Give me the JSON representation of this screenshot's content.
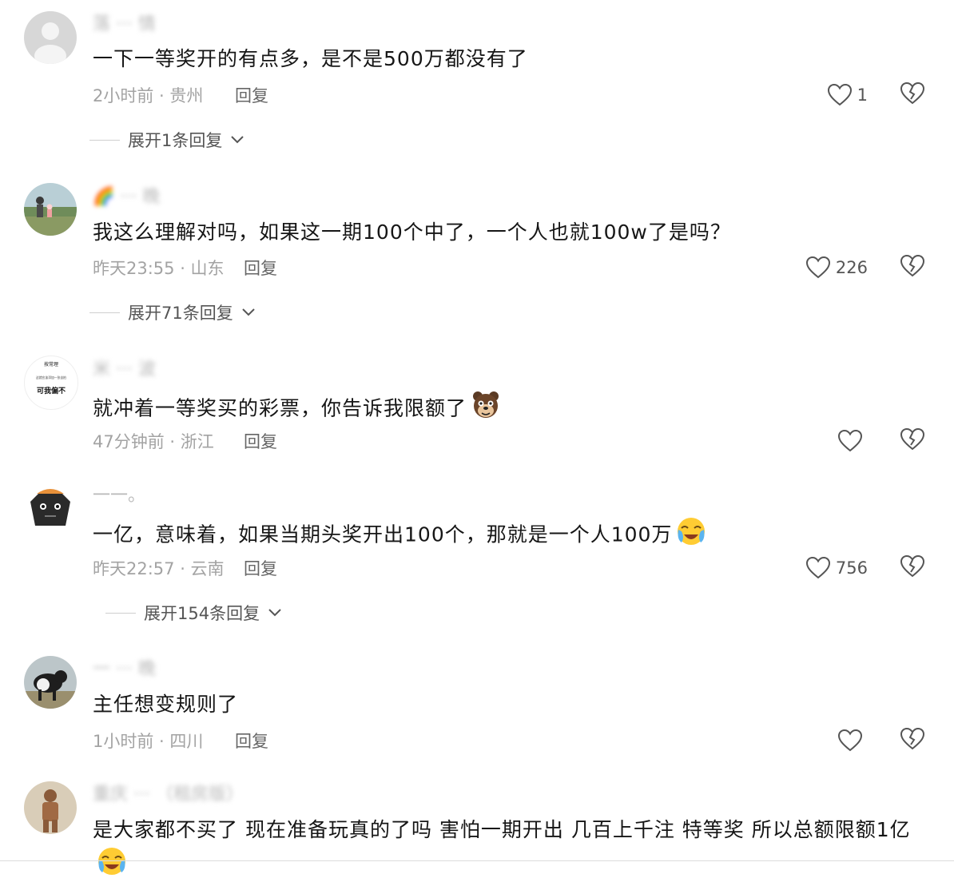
{
  "comments": [
    {
      "username": "落 ··· 情",
      "text": "一下一等奖开的有点多，是不是500万都没有了",
      "meta": "2小时前 · 贵州",
      "reply_label": "回复",
      "likes": "1",
      "expand_label": "展开1条回复"
    },
    {
      "username": "🌈 ··· 晚",
      "text": "我这么理解对吗，如果这一期100个中了，一个人也就100w了是吗？",
      "meta": "昨天23:55 · 山东",
      "reply_label": "回复",
      "likes": "226",
      "expand_label": "展开71条回复"
    },
    {
      "username": "米 ··· 波",
      "text": "就冲着一等奖买的彩票，你告诉我限额了",
      "meta": "47分钟前 · 浙江",
      "reply_label": "回复",
      "likes": "",
      "avatar_text": [
        "按常理",
        "这就应该添加一张自拍",
        "可我偏不"
      ]
    },
    {
      "username": "一一。",
      "text": "一亿，意味着，如果当期头奖开出100个，那就是一个人100万",
      "meta": "昨天22:57 · 云南",
      "reply_label": "回复",
      "likes": "756",
      "expand_label": "展开154条回复"
    },
    {
      "username": "一 ··· 晚",
      "text": "主任想变规则了",
      "meta": "1小时前 · 四川",
      "reply_label": "回复",
      "likes": ""
    },
    {
      "username": "重庆 ··· （租房版）",
      "text": "是大家都不买了 现在准备玩真的了吗 害怕一期开出 几百上千注 特等奖 所以总额限额1亿"
    }
  ],
  "colors": {
    "text": "#161616",
    "meta": "#a3a3a3",
    "icon": "#555555",
    "background": "#ffffff"
  },
  "icons": [
    "heart-icon",
    "broken-heart-icon",
    "chevron-down-icon"
  ]
}
